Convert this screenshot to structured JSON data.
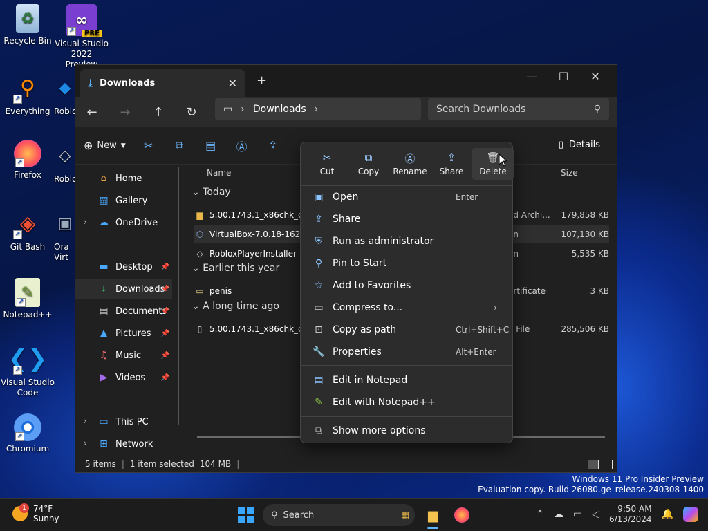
{
  "desktop": {
    "icons": [
      {
        "label": "Recycle Bin"
      },
      {
        "label": "Visual Studio 2022 Preview",
        "badge": "PRE"
      },
      {
        "label": "Everything"
      },
      {
        "label": "Roblo"
      },
      {
        "label": "Firefox"
      },
      {
        "label": "Roblo"
      },
      {
        "label": "Git Bash"
      },
      {
        "label": "Ora Virt"
      },
      {
        "label": "Notepad++"
      },
      {
        "label": "Visual Studio Code"
      },
      {
        "label": "Chromium"
      }
    ]
  },
  "window": {
    "tab_title": "Downloads",
    "breadcrumb": "Downloads",
    "search_placeholder": "Search Downloads",
    "new_label": "New",
    "details_label": "Details",
    "columns": {
      "name": "Name",
      "size": "Size"
    }
  },
  "sidebar": {
    "items": [
      {
        "label": "Home"
      },
      {
        "label": "Gallery"
      },
      {
        "label": "OneDrive"
      },
      {
        "label": "Desktop"
      },
      {
        "label": "Downloads"
      },
      {
        "label": "Documents"
      },
      {
        "label": "Pictures"
      },
      {
        "label": "Music"
      },
      {
        "label": "Videos"
      },
      {
        "label": "This PC"
      },
      {
        "label": "Network"
      }
    ]
  },
  "files": {
    "groups": [
      "Today",
      "Earlier this year",
      "A long time ago"
    ],
    "rows": [
      {
        "name": "5.00.1743.1_x86chk_clien",
        "type": "ed Archi...",
        "size": "179,858 KB"
      },
      {
        "name": "VirtualBox-7.0.18-162988",
        "type": "on",
        "size": "107,130 KB"
      },
      {
        "name": "RobloxPlayerInstaller",
        "type": "on",
        "size": "5,535 KB"
      },
      {
        "name": "penis",
        "type": "ertificate",
        "size": "3 KB"
      },
      {
        "name": "5.00.1743.1_x86chk_clien",
        "type": "e File",
        "size": "285,506 KB"
      }
    ]
  },
  "status": {
    "items": "5 items",
    "selected": "1 item selected",
    "size": "104 MB"
  },
  "context_menu": {
    "actions": [
      {
        "label": "Cut"
      },
      {
        "label": "Copy"
      },
      {
        "label": "Rename"
      },
      {
        "label": "Share"
      },
      {
        "label": "Delete"
      }
    ],
    "items": [
      {
        "label": "Open",
        "shortcut": "Enter"
      },
      {
        "label": "Share",
        "shortcut": ""
      },
      {
        "label": "Run as administrator",
        "shortcut": ""
      },
      {
        "label": "Pin to Start",
        "shortcut": ""
      },
      {
        "label": "Add to Favorites",
        "shortcut": ""
      },
      {
        "label": "Compress to...",
        "shortcut": ""
      },
      {
        "label": "Copy as path",
        "shortcut": "Ctrl+Shift+C"
      },
      {
        "label": "Properties",
        "shortcut": "Alt+Enter"
      },
      {
        "label": "Edit in Notepad",
        "shortcut": ""
      },
      {
        "label": "Edit with Notepad++",
        "shortcut": ""
      },
      {
        "label": "Show more options",
        "shortcut": ""
      }
    ]
  },
  "watermark": {
    "line1": "Windows 11 Pro Insider Preview",
    "line2": "Evaluation copy. Build 26080.ge_release.240308-1400"
  },
  "taskbar": {
    "temp": "74°F",
    "condition": "Sunny",
    "weather_badge": "1",
    "search_label": "Search",
    "time": "9:50 AM",
    "date": "6/13/2024"
  }
}
